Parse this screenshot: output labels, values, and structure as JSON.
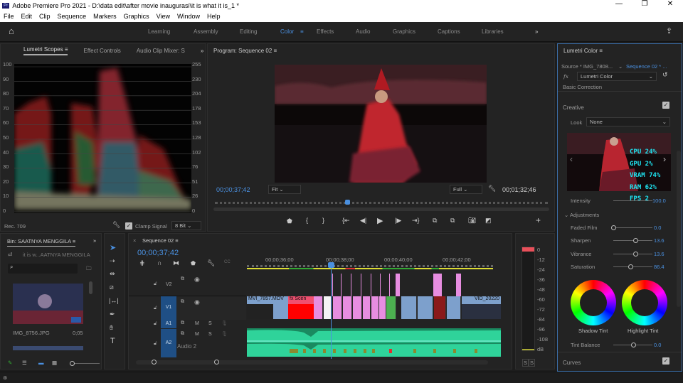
{
  "window": {
    "title": "Adobe Premiere Pro 2021 - D:\\data edit\\after movie inaugurasi\\it is what it is_1 *",
    "app_badge": "Pr",
    "min": "—",
    "max": "❐",
    "close": "✕"
  },
  "menu": [
    "File",
    "Edit",
    "Clip",
    "Sequence",
    "Markers",
    "Graphics",
    "View",
    "Window",
    "Help"
  ],
  "workspaces": {
    "items": [
      "Learning",
      "Assembly",
      "Editing",
      "Color",
      "Effects",
      "Audio",
      "Graphics",
      "Captions",
      "Libraries"
    ],
    "active": "Color",
    "more": "»"
  },
  "scopes": {
    "tabs": [
      "Lumetri Scopes",
      "Effect Controls",
      "Audio Clip Mixer: S"
    ],
    "more": "»",
    "left_scale": [
      "100",
      "90",
      "80",
      "70",
      "60",
      "50",
      "40",
      "30",
      "20",
      "10",
      "0"
    ],
    "right_scale": [
      "255",
      "230",
      "204",
      "178",
      "153",
      "128",
      "102",
      "76",
      "51",
      "26",
      "0"
    ],
    "standard": "Rec. 709",
    "clamp_label": "Clamp Signal",
    "bit_depth": "8 Bit"
  },
  "program": {
    "title": "Program: Sequence 02",
    "timecode": "00;00;37;42",
    "fit": "Fit",
    "quality": "Full",
    "duration": "00;01;32;46"
  },
  "lumetri": {
    "title": "Lumetri Color",
    "source": "Source * IMG_7808...",
    "sequence": "Sequence 02 * ...",
    "effect": "Lumetri Color",
    "basic": "Basic Correction",
    "creative": "Creative",
    "look_label": "Look",
    "look_value": "None",
    "intensity_label": "Intensity",
    "intensity_value": "100.0",
    "intensity": 100,
    "overlay": [
      "CPU  24%",
      "GPU  2%",
      "VRAM  74%",
      "RAM  62%",
      "FPS  2"
    ],
    "adjustments": "Adjustments",
    "sliders": [
      {
        "label": "Faded Film",
        "value": "0.0",
        "pos": 0
      },
      {
        "label": "Sharpen",
        "value": "13.6",
        "pos": 0.57
      },
      {
        "label": "Vibrance",
        "value": "13.6",
        "pos": 0.57
      },
      {
        "label": "Saturation",
        "value": "86.4",
        "pos": 0.43
      }
    ],
    "shadow_tint": "Shadow Tint",
    "highlight_tint": "Highlight Tint",
    "tint_balance_label": "Tint Balance",
    "tint_balance_value": "0.0",
    "tint_balance": 0.5,
    "curves": "Curves"
  },
  "bin": {
    "title": "Bin: SAATNYA MENGGILA",
    "path": "it is w...AATNYA MENGGILA",
    "search_placeholder": "",
    "item_name": "IMG_8756.JPG",
    "item_duration": "0;05"
  },
  "timeline": {
    "title": "Sequence 02",
    "timecode": "00;00;37;42",
    "ruler": [
      "00;00;36;00",
      "00;00;38;00",
      "00;00;40;00",
      "00;00;42;00"
    ],
    "tracks": {
      "v2": "V2",
      "v1": "V1",
      "a1": "A1",
      "a2": "A2",
      "a2_name": "Audio 2",
      "m": "M",
      "s": "S"
    },
    "clips": {
      "c1": "MVI_7857.MOV",
      "c2": "Scen",
      "c3": "VID_20220"
    }
  },
  "meter": {
    "scale": [
      "0",
      "-12",
      "-24",
      "-36",
      "-48",
      "-60",
      "-72",
      "-84",
      "-96",
      "-108",
      "dB"
    ],
    "solo": [
      "S",
      "S"
    ]
  }
}
